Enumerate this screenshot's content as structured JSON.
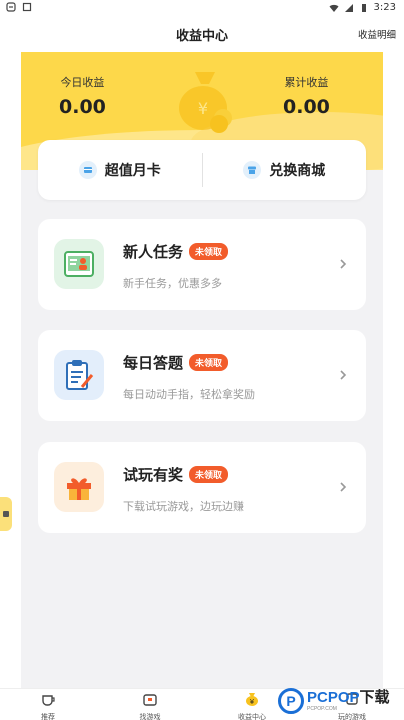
{
  "status_bar": {
    "time": "3:23"
  },
  "header": {
    "title": "收益中心",
    "detail_link": "收益明细"
  },
  "earnings": {
    "today_label": "今日收益",
    "today_value": "0.00",
    "total_label": "累计收益",
    "total_value": "0.00"
  },
  "quick_links": {
    "monthly_card": "超值月卡",
    "exchange_mall": "兑换商城"
  },
  "tasks": [
    {
      "title": "新人任务",
      "badge": "未领取",
      "subtitle": "新手任务，优惠多多"
    },
    {
      "title": "每日答题",
      "badge": "未领取",
      "subtitle": "每日动动手指，轻松拿奖励"
    },
    {
      "title": "试玩有奖",
      "badge": "未领取",
      "subtitle": "下载试玩游戏，边玩边赚"
    }
  ],
  "tabbar": [
    "推荐",
    "找游戏",
    "收益中心",
    "玩的游戏"
  ],
  "watermark": {
    "logo": "P",
    "brand": "PCPOP",
    "suffix": "下载",
    "sub": "PCPOP.COM"
  },
  "colors": {
    "hero_yellow": "#fdd84a",
    "badge_orange": "#f25c2b",
    "page_bg": "#f2f2f4",
    "watermark_blue": "#1a6fd6"
  }
}
